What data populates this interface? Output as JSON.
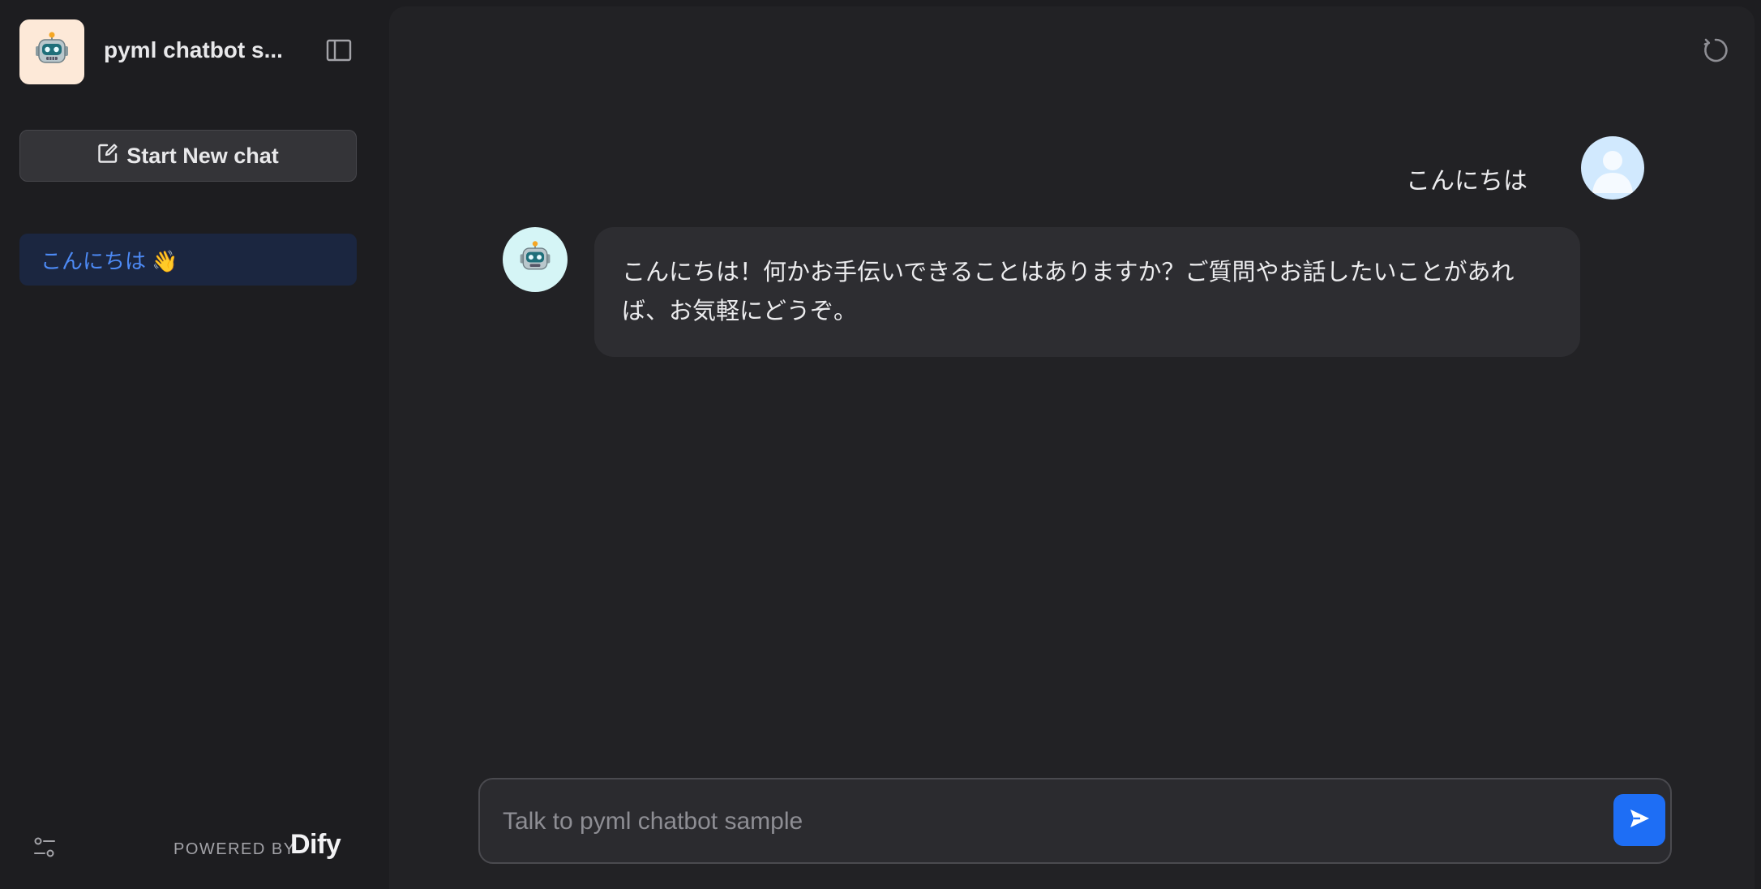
{
  "sidebar": {
    "app_title": "pyml chatbot s...",
    "new_chat_label": "Start New chat",
    "conversations": [
      {
        "label": "こんにちは 👋",
        "active": true
      }
    ],
    "powered_by_label": "POWERED BY",
    "brand_name": "Dify",
    "icons": {
      "logo": "robot-icon",
      "collapse": "sidebar-toggle-icon",
      "new_chat": "edit-icon",
      "settings": "settings-sliders-icon"
    }
  },
  "chat": {
    "messages": [
      {
        "role": "user",
        "text": "こんにちは"
      },
      {
        "role": "assistant",
        "text": "こんにちは！何かお手伝いできることはありますか？ご質問やお話したいことがあれば、お気軽にどうぞ。"
      }
    ],
    "input_placeholder": "Talk to pyml chatbot sample",
    "input_value": "",
    "icons": {
      "refresh": "refresh-icon",
      "send": "send-icon",
      "user_avatar": "user-avatar-icon",
      "bot_avatar": "robot-icon"
    }
  },
  "colors": {
    "background": "#1d1d20",
    "panel": "#222225",
    "accent": "#1e6ef5",
    "active_conversation_text": "#4d8af5",
    "active_conversation_bg": "#1b2640",
    "logo_bg": "#fde9d8",
    "bot_avatar_bg": "#d5f5f6",
    "user_avatar_bg": "#d1e9fe"
  }
}
